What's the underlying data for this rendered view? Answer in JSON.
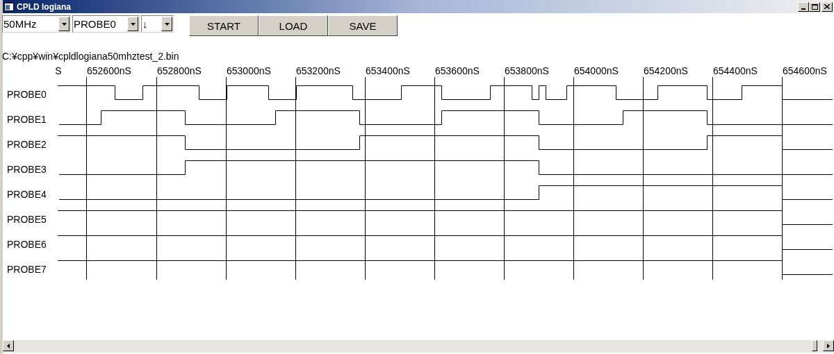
{
  "window": {
    "title": "CPLD logiana"
  },
  "toolbar": {
    "dropdowns": [
      {
        "value": "50MHz"
      },
      {
        "value": "PROBE0"
      },
      {
        "value": "↓"
      }
    ],
    "buttons": [
      "START",
      "LOAD",
      "SAVE"
    ]
  },
  "file_path": "C:¥cpp¥win¥cpldlogiana50mhztest_2.bin",
  "time_axis": {
    "labels": [
      "S",
      "652600nS",
      "652800nS",
      "653000nS",
      "653200nS",
      "653400nS",
      "653600nS",
      "653800nS",
      "654000nS",
      "654200nS",
      "654400nS",
      "654600nS"
    ]
  },
  "probes": [
    "PROBE0",
    "PROBE1",
    "PROBE2",
    "PROBE3",
    "PROBE4",
    "PROBE5",
    "PROBE6",
    "PROBE7"
  ]
}
